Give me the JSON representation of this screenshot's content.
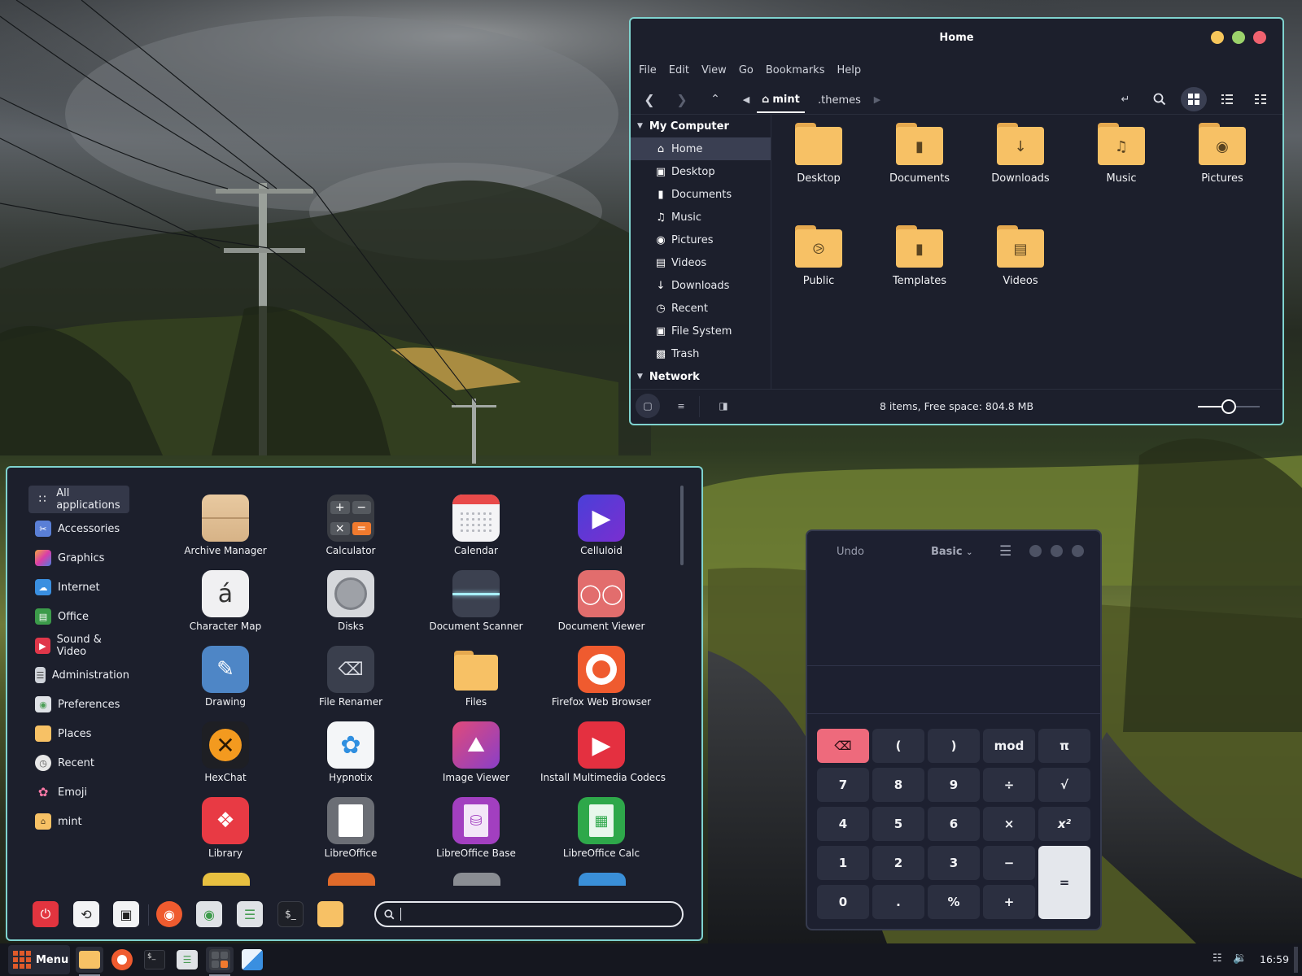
{
  "files_window": {
    "title": "Home",
    "menus": [
      "File",
      "Edit",
      "View",
      "Go",
      "Bookmarks",
      "Help"
    ],
    "breadcrumbs": [
      "mint",
      ".themes"
    ],
    "sidebar": {
      "section_computer": "My Computer",
      "items": [
        {
          "label": "Home",
          "icon": "home-icon",
          "selected": true
        },
        {
          "label": "Desktop",
          "icon": "desktop-icon"
        },
        {
          "label": "Documents",
          "icon": "document-icon"
        },
        {
          "label": "Music",
          "icon": "music-icon"
        },
        {
          "label": "Pictures",
          "icon": "camera-icon"
        },
        {
          "label": "Videos",
          "icon": "film-icon"
        },
        {
          "label": "Downloads",
          "icon": "download-icon"
        },
        {
          "label": "Recent",
          "icon": "clock-icon"
        },
        {
          "label": "File System",
          "icon": "drive-icon"
        },
        {
          "label": "Trash",
          "icon": "trash-icon"
        }
      ],
      "section_network": "Network"
    },
    "folders": [
      {
        "label": "Desktop",
        "icon": "folder-icon"
      },
      {
        "label": "Documents",
        "icon": "folder-documents-icon"
      },
      {
        "label": "Downloads",
        "icon": "folder-download-icon"
      },
      {
        "label": "Music",
        "icon": "folder-music-icon"
      },
      {
        "label": "Pictures",
        "icon": "folder-pictures-icon"
      },
      {
        "label": "Public",
        "icon": "folder-share-icon"
      },
      {
        "label": "Templates",
        "icon": "folder-templates-icon"
      },
      {
        "label": "Videos",
        "icon": "folder-videos-icon"
      }
    ],
    "status_text": "8 items, Free space: 804.8 MB",
    "zoom_level": 0.5
  },
  "app_menu": {
    "categories": [
      {
        "label": "All applications",
        "icon": "grid-icon",
        "selected": true
      },
      {
        "label": "Accessories",
        "icon": "scissors-icon"
      },
      {
        "label": "Graphics",
        "icon": "graphics-icon"
      },
      {
        "label": "Internet",
        "icon": "cloud-icon"
      },
      {
        "label": "Office",
        "icon": "office-icon"
      },
      {
        "label": "Sound & Video",
        "icon": "play-icon"
      },
      {
        "label": "Administration",
        "icon": "admin-icon"
      },
      {
        "label": "Preferences",
        "icon": "toggle-icon"
      },
      {
        "label": "Places",
        "icon": "folder-icon"
      },
      {
        "label": "Recent",
        "icon": "clock-icon"
      },
      {
        "label": "Emoji",
        "icon": "tulip-icon"
      },
      {
        "label": "mint",
        "icon": "home-folder-icon"
      }
    ],
    "apps": [
      {
        "label": "Archive Manager",
        "icon": "archive-icon"
      },
      {
        "label": "Calculator",
        "icon": "calculator-icon"
      },
      {
        "label": "Calendar",
        "icon": "calendar-icon"
      },
      {
        "label": "Celluloid",
        "icon": "celluloid-icon"
      },
      {
        "label": "Character Map",
        "icon": "character-map-icon",
        "glyph": "á"
      },
      {
        "label": "Disks",
        "icon": "disks-icon"
      },
      {
        "label": "Document Scanner",
        "icon": "scanner-icon"
      },
      {
        "label": "Document Viewer",
        "icon": "glasses-icon"
      },
      {
        "label": "Drawing",
        "icon": "pencil-icon"
      },
      {
        "label": "File Renamer",
        "icon": "renamer-icon"
      },
      {
        "label": "Files",
        "icon": "folder-icon"
      },
      {
        "label": "Firefox Web Browser",
        "icon": "firefox-icon"
      },
      {
        "label": "HexChat",
        "icon": "hexchat-icon"
      },
      {
        "label": "Hypnotix",
        "icon": "hypnotix-icon"
      },
      {
        "label": "Image Viewer",
        "icon": "image-viewer-icon"
      },
      {
        "label": "Install Multimedia Codecs",
        "icon": "codecs-icon"
      },
      {
        "label": "Library",
        "icon": "tag-icon"
      },
      {
        "label": "LibreOffice",
        "icon": "libreoffice-icon"
      },
      {
        "label": "LibreOffice Base",
        "icon": "libreoffice-base-icon"
      },
      {
        "label": "LibreOffice Calc",
        "icon": "libreoffice-calc-icon"
      }
    ],
    "search": {
      "value": ""
    }
  },
  "calculator": {
    "undo_label": "Undo",
    "mode_label": "Basic",
    "keys": [
      [
        "⌫",
        "(",
        ")",
        "mod",
        "π"
      ],
      [
        "7",
        "8",
        "9",
        "÷",
        "√"
      ],
      [
        "4",
        "5",
        "6",
        "×",
        "x²"
      ],
      [
        "1",
        "2",
        "3",
        "−",
        "="
      ],
      [
        "0",
        ".",
        "%",
        "+"
      ]
    ]
  },
  "taskbar": {
    "menu_label": "Menu",
    "clock": "16:59"
  },
  "colors": {
    "accent_border": "#7fd3cf",
    "folder": "#f7c165",
    "window_bg": "#1c1f2c",
    "close": "#f0626f",
    "minimize": "#f6c65b",
    "maximize": "#9bd26b"
  }
}
